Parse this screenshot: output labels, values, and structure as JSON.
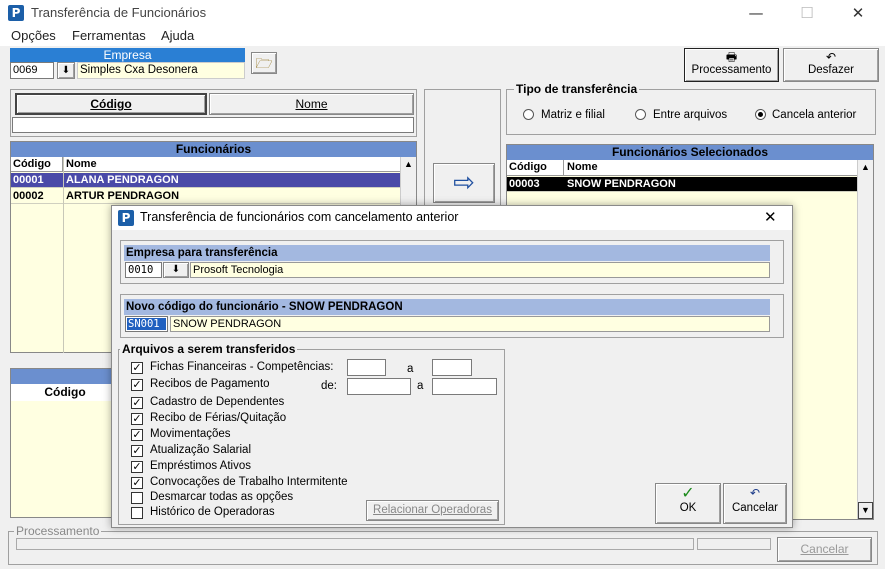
{
  "window": {
    "title": "Transferência de Funcionários",
    "logo": "P",
    "minimize": "—",
    "maximize": "☐",
    "close": "✕"
  },
  "menu": [
    "Opções",
    "Ferramentas",
    "Ajuda"
  ],
  "empresa": {
    "label": "Empresa",
    "code": "0069",
    "name": "Simples Cxa Desonera"
  },
  "toolbar": {
    "processamento_label": "Processamento",
    "desfazer_label": "Desfazer"
  },
  "search": {
    "tab_codigo": "Código",
    "tab_nome": "Nome",
    "value": ""
  },
  "funcionarios": {
    "title": "Funcionários",
    "col_codigo": "Código",
    "col_nome": "Nome",
    "rows": [
      {
        "codigo": "00001",
        "nome": "ALANA PENDRAGON"
      },
      {
        "codigo": "00002",
        "nome": "ARTUR PENDRAGON"
      }
    ]
  },
  "lower_grid": {
    "col_codigo": "Código"
  },
  "tipo_transferencia": {
    "title": "Tipo de transferência",
    "options": [
      "Matriz e filial",
      "Entre arquivos",
      "Cancela anterior"
    ],
    "selected": "Cancela anterior"
  },
  "selecionados": {
    "title": "Funcionários Selecionados",
    "col_codigo": "Código",
    "col_nome": "Nome",
    "rows": [
      {
        "codigo": "00003",
        "nome": "SNOW PENDRAGON"
      }
    ]
  },
  "processamento": {
    "label": "Processamento",
    "cancel_label": "Cancelar"
  },
  "dialog": {
    "title": "Transferência de funcionários com cancelamento anterior",
    "close": "✕",
    "empresa_header": "Empresa para transferência",
    "empresa_code": "0010",
    "empresa_name": "Prosoft Tecnologia",
    "novo_codigo_header": "Novo código do funcionário - SNOW PENDRAGON",
    "novo_codigo_value": "SN001",
    "novo_codigo_name": "SNOW PENDRAGON",
    "arquivos_title": "Arquivos a serem transferidos",
    "competencias_a": "a",
    "recibos_de": "de:",
    "recibos_a": "a",
    "checkboxes": [
      {
        "label": "Fichas Financeiras - Competências:",
        "checked": true
      },
      {
        "label": "Recibos de Pagamento",
        "checked": true
      },
      {
        "label": "Cadastro de Dependentes",
        "checked": true
      },
      {
        "label": "Recibo de Férias/Quitação",
        "checked": true
      },
      {
        "label": "Movimentações",
        "checked": true
      },
      {
        "label": "Atualização Salarial",
        "checked": true
      },
      {
        "label": "Empréstimos Ativos",
        "checked": true
      },
      {
        "label": "Convocações de Trabalho Intermitente",
        "checked": true
      },
      {
        "label": "Desmarcar todas as opções",
        "checked": false
      },
      {
        "label": "Histórico de Operadoras",
        "checked": false
      }
    ],
    "relacionar_label": "Relacionar Operadoras",
    "ok_label": "OK",
    "cancelar_label": "Cancelar"
  }
}
